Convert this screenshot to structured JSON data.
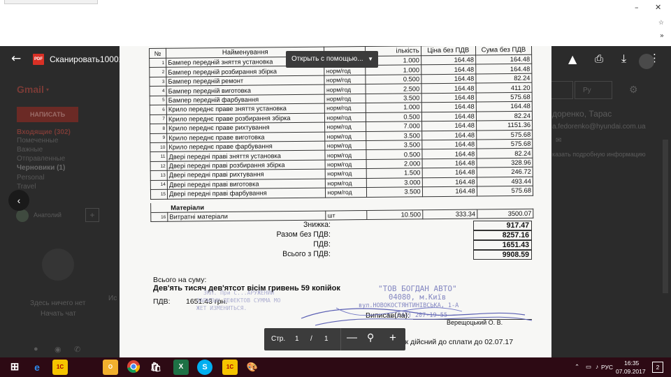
{
  "browser": {
    "minimize": "–",
    "close": "✕",
    "more": "»"
  },
  "gmail": {
    "logo": "Gmail",
    "compose": "НАПИСАТЬ",
    "folders": [
      {
        "label": "Входящие (302)",
        "style": "active"
      },
      {
        "label": "Помеченные",
        "style": ""
      },
      {
        "label": "Важные",
        "style": ""
      },
      {
        "label": "Отправленные",
        "style": ""
      },
      {
        "label": "Черновики (1)",
        "style": "bold"
      },
      {
        "label": "Personal",
        "style": ""
      },
      {
        "label": "Travel",
        "style": ""
      }
    ],
    "account": "Анатолий",
    "empty_text": "Здесь ничего нет",
    "start_chat": "Начать чат",
    "sender_name": "доренко, Тарас",
    "sender_email": "a.fedorenko@hyundai.com.ua",
    "details_link": "казать подробную информацию",
    "lang": "Ру",
    "nav_letter": "Ис"
  },
  "viewer": {
    "file_title": "Сканировать10001.PDF",
    "pdf_badge": "PDF",
    "open_with": "Открыть с помощью...",
    "page_label": "Стр.",
    "page_current": "1",
    "page_sep": "/",
    "page_total": "1"
  },
  "document": {
    "headers": {
      "num": "№",
      "name": "Найменування",
      "unit": "",
      "qty": "ількість",
      "price": "Ціна без ПДВ",
      "sum": "Сума без ПДВ"
    },
    "rows": [
      {
        "n": "1",
        "name": "Бампер передній зняття установка",
        "unit": "норм/год",
        "qty": "1.000",
        "price": "164.48",
        "sum": "164.48"
      },
      {
        "n": "2",
        "name": "Бампер передній розбирання збірка",
        "unit": "норм/год",
        "qty": "1.000",
        "price": "164.48",
        "sum": "164.48"
      },
      {
        "n": "3",
        "name": "Бампер передній ремонт",
        "unit": "норм/год",
        "qty": "0.500",
        "price": "164.48",
        "sum": "82.24"
      },
      {
        "n": "4",
        "name": "Бампер передній виготовка",
        "unit": "норм/год",
        "qty": "2.500",
        "price": "164.48",
        "sum": "411.20"
      },
      {
        "n": "5",
        "name": "Бампер передній фарбування",
        "unit": "норм/год",
        "qty": "3.500",
        "price": "164.48",
        "sum": "575.68"
      },
      {
        "n": "6",
        "name": "Крило переднє праве зняття установка",
        "unit": "норм/год",
        "qty": "1.000",
        "price": "164.48",
        "sum": "164.48"
      },
      {
        "n": "7",
        "name": "Крило переднє праве розбирання збірка",
        "unit": "норм/год",
        "qty": "0.500",
        "price": "164.48",
        "sum": "82.24"
      },
      {
        "n": "8",
        "name": "Крило переднє праве рихтування",
        "unit": "норм/год",
        "qty": "7.000",
        "price": "164.48",
        "sum": "1151.36"
      },
      {
        "n": "9",
        "name": "Крило переднє праве виготовка",
        "unit": "норм/год",
        "qty": "3.500",
        "price": "164.48",
        "sum": "575.68"
      },
      {
        "n": "10",
        "name": "Крило переднє праве фарбування",
        "unit": "норм/год",
        "qty": "3.500",
        "price": "164.48",
        "sum": "575.68"
      },
      {
        "n": "11",
        "name": "Двері передні праві зняття установка",
        "unit": "норм/год",
        "qty": "0.500",
        "price": "164.48",
        "sum": "82.24"
      },
      {
        "n": "12",
        "name": "Двері передні праві розбирання збірка",
        "unit": "норм/год",
        "qty": "2.000",
        "price": "164.48",
        "sum": "328.96"
      },
      {
        "n": "13",
        "name": "Двері передні праві рихтування",
        "unit": "норм/год",
        "qty": "1.500",
        "price": "164.48",
        "sum": "246.72"
      },
      {
        "n": "14",
        "name": "Двері передні праві виготовка",
        "unit": "норм/год",
        "qty": "3.000",
        "price": "164.48",
        "sum": "493.44"
      },
      {
        "n": "15",
        "name": "Двері передні праві фарбування",
        "unit": "норм/год",
        "qty": "3.500",
        "price": "164.48",
        "sum": "575.68"
      }
    ],
    "materials_label": "Матеріали",
    "material_row": {
      "n": "16",
      "name": "Витратні матеріали",
      "unit": "шт",
      "qty": "10.500",
      "price": "333.34",
      "sum": "3500.07"
    },
    "totals": [
      {
        "label": "Знижка:",
        "value": "917.47"
      },
      {
        "label": "Разом без ПДВ:",
        "value": "8257.16"
      },
      {
        "label": "ПДВ:",
        "value": "1651.43"
      },
      {
        "label": "Всього з ПДВ:",
        "value": "9908.59"
      }
    ],
    "sum_intro": "Всього на суму:",
    "sum_words": "Дев'ять тисяч дев'ятсот вісім гривень 59 копійок",
    "vat_label": "ПДВ:",
    "vat_value": "1651.43 грн.",
    "stamp_line1": "\"ТОВ БОГДАН АВТО\"",
    "stamp_line2": "04080, м.Київ",
    "stamp_line3": "вул.НОВОКОСТЯНТИНІВСЬКА, 1-А",
    "stamp_line4": "т.(044) 207-19-55",
    "stamp_left1": "ЗКП. При С...АРУЖЕНИИ",
    "stamp_left2": "ЗАРЫТЫХ ДЕФЕКТОВ СУММА МО",
    "stamp_left3": "ЖЕТ ИЗМЕНИТЬСЯ.",
    "written_by": "Виписав(ла):",
    "signer": "Верещоцький О. В.",
    "due_text": "Рахунок дійсний до сплати до 02.07.17"
  },
  "taskbar": {
    "lang": "РУС",
    "time": "16:35",
    "date": "07.09.2017",
    "notifications": "2"
  },
  "colors": {
    "gmail_red": "#7a3b36",
    "pdf_red": "#d93025",
    "stamp_blue": "#6f73b8",
    "taskbar": "#2d0a14"
  }
}
